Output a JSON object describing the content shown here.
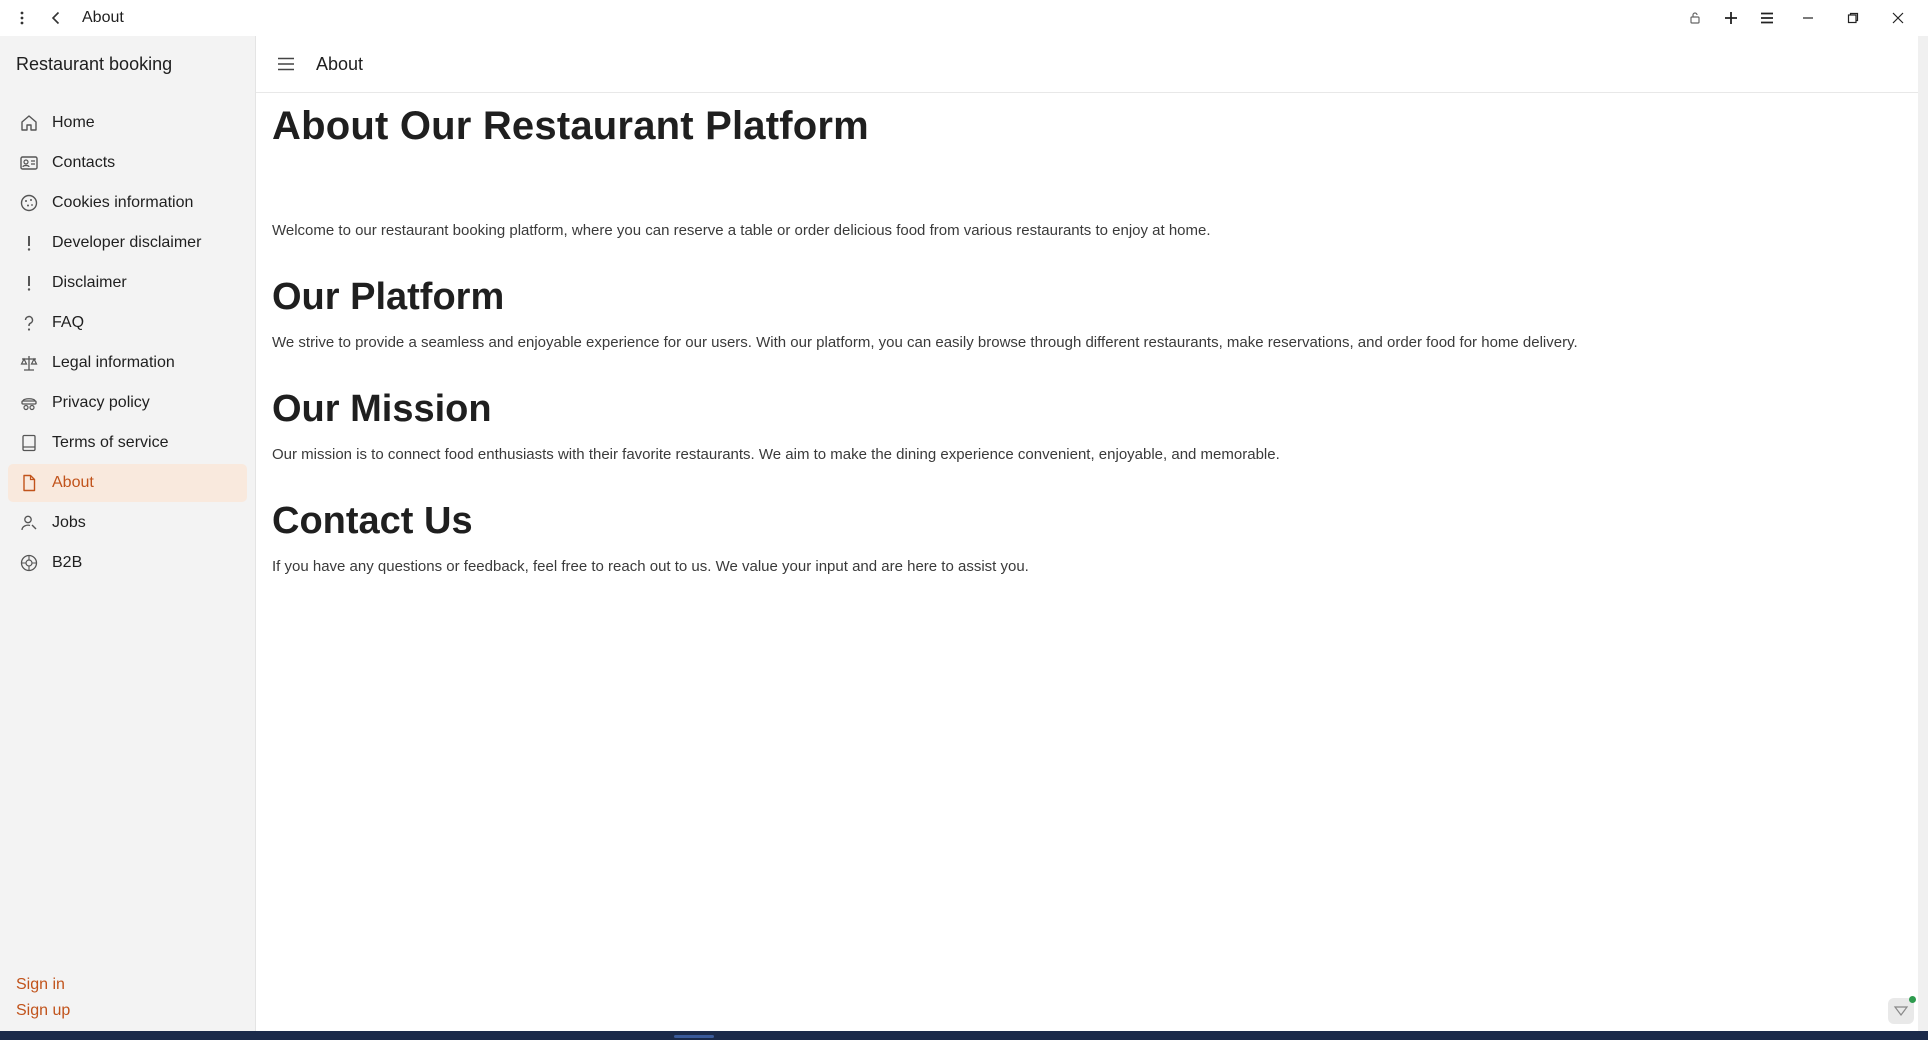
{
  "titlebar": {
    "title": "About",
    "icons": [
      "more-vertical-icon",
      "back-arrow-icon",
      "lock-icon",
      "plus-icon",
      "menu-icon",
      "minimize-icon",
      "restore-icon",
      "close-icon"
    ]
  },
  "sidebar": {
    "app_name": "Restaurant booking",
    "items": [
      {
        "label": "Home",
        "icon": "home-icon"
      },
      {
        "label": "Contacts",
        "icon": "contact-card-icon"
      },
      {
        "label": "Cookies information",
        "icon": "cookie-icon"
      },
      {
        "label": "Developer disclaimer",
        "icon": "exclamation-icon"
      },
      {
        "label": "Disclaimer",
        "icon": "exclamation-icon"
      },
      {
        "label": "FAQ",
        "icon": "question-icon"
      },
      {
        "label": "Legal information",
        "icon": "scales-icon"
      },
      {
        "label": "Privacy policy",
        "icon": "privacy-icon"
      },
      {
        "label": "Terms of service",
        "icon": "document-icon"
      },
      {
        "label": "About",
        "icon": "page-icon",
        "active": true
      },
      {
        "label": "Jobs",
        "icon": "person-icon"
      },
      {
        "label": "B2B",
        "icon": "globe-icon"
      }
    ],
    "sign_in": "Sign in",
    "sign_up": "Sign up"
  },
  "main": {
    "header_title": "About",
    "heading": "About Our Restaurant Platform",
    "intro": "Welcome to our restaurant booking platform, where you can reserve a table or order delicious food from various restaurants to enjoy at home.",
    "sections": [
      {
        "title": "Our Platform",
        "text": "We strive to provide a seamless and enjoyable experience for our users. With our platform, you can easily browse through different restaurants, make reservations, and order food for home delivery."
      },
      {
        "title": "Our Mission",
        "text": "Our mission is to connect food enthusiasts with their favorite restaurants. We aim to make the dining experience convenient, enjoyable, and memorable."
      },
      {
        "title": "Contact Us",
        "text": "If you have any questions or feedback, feel free to reach out to us. We value your input and are here to assist you."
      }
    ]
  },
  "colors": {
    "accent": "#c1531b",
    "active_bg": "#f9e9dd",
    "sidebar_bg": "#f3f3f3"
  }
}
